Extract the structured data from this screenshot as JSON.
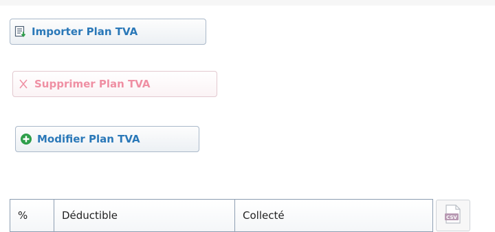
{
  "buttons": {
    "import_label": "Importer Plan TVA",
    "delete_label": "Supprimer Plan TVA",
    "modify_label": "Modifier Plan TVA"
  },
  "table": {
    "columns": [
      "%",
      "Déductible",
      "Collecté"
    ]
  },
  "export": {
    "csv_label": "CSV"
  },
  "colors": {
    "accent": "#2a78b8",
    "disabled_text": "#ef8fa3",
    "add_icon": "#2e9e4a"
  }
}
